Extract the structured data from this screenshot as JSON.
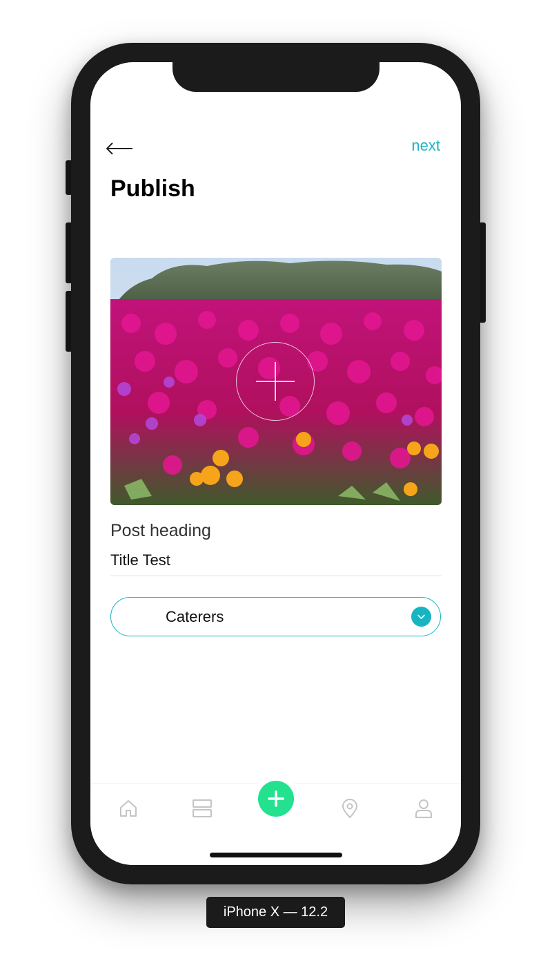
{
  "device": {
    "caption": "iPhone X — 12.2"
  },
  "header": {
    "back_icon": "arrow-left-icon",
    "next_label": "next",
    "title": "Publish"
  },
  "photo": {
    "description_icon": "add-photo-plus-icon"
  },
  "form": {
    "heading_label": "Post heading",
    "heading_value": "Title Test",
    "category_value": "Caterers",
    "category_icon": "chevron-down-icon"
  },
  "tabbar": {
    "items": [
      {
        "icon": "home-icon"
      },
      {
        "icon": "feed-icon"
      },
      {
        "icon": "add-icon"
      },
      {
        "icon": "map-pin-icon"
      },
      {
        "icon": "profile-icon"
      }
    ]
  },
  "colors": {
    "accent": "#17b5c2",
    "fab": "#23e18f",
    "frame": "#1b1b1b"
  }
}
